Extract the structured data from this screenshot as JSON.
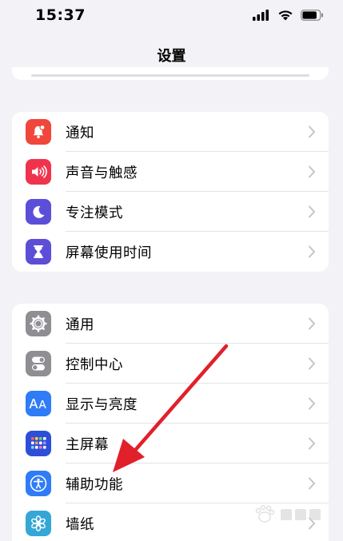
{
  "status_bar": {
    "time": "15:37",
    "icons": [
      "signal-icon",
      "wifi-icon",
      "battery-icon"
    ]
  },
  "nav": {
    "title": "设置"
  },
  "groups": [
    {
      "items": [
        {
          "label": "通知",
          "icon": "notification-bell-icon",
          "color": "#f0463b"
        },
        {
          "label": "声音与触感",
          "icon": "speaker-icon",
          "color": "#f0334d"
        },
        {
          "label": "专注模式",
          "icon": "moon-icon",
          "color": "#5b4fd9"
        },
        {
          "label": "屏幕使用时间",
          "icon": "hourglass-icon",
          "color": "#5c4ed6"
        }
      ]
    },
    {
      "items": [
        {
          "label": "通用",
          "icon": "gear-icon",
          "color": "#8e8e93"
        },
        {
          "label": "控制中心",
          "icon": "toggle-switches-icon",
          "color": "#8e8e93"
        },
        {
          "label": "显示与亮度",
          "icon": "text-size-aa-icon",
          "color": "#2f7cf6"
        },
        {
          "label": "主屏幕",
          "icon": "home-screen-grid-icon",
          "color": "#2d4fd8"
        },
        {
          "label": "辅助功能",
          "icon": "accessibility-person-icon",
          "color": "#2f7cf6"
        },
        {
          "label": "墙纸",
          "icon": "flower-wallpaper-icon",
          "color": "#35a7d6"
        }
      ]
    }
  ],
  "annotation": {
    "arrow_color": "#e0202a"
  }
}
